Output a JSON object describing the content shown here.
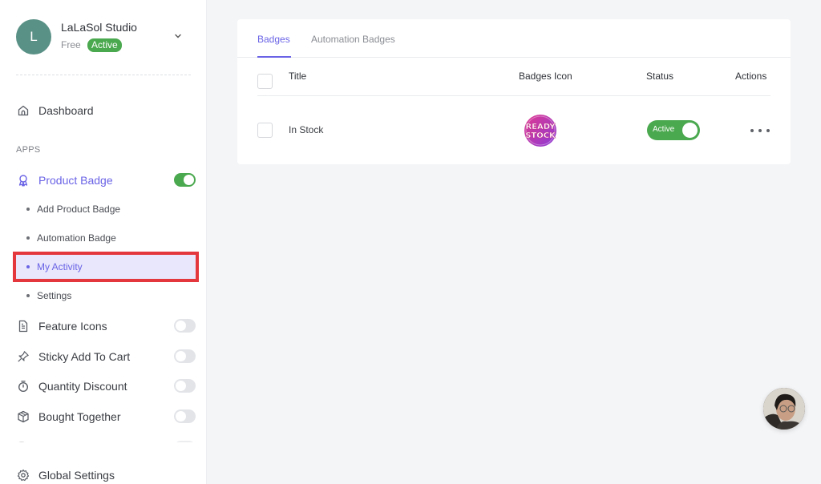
{
  "account": {
    "initial": "L",
    "name": "LaLaSol Studio",
    "plan": "Free",
    "status": "Active"
  },
  "sidebar": {
    "dashboard": {
      "label": "Dashboard",
      "icon": "home-icon"
    },
    "section_label": "APPS",
    "apps": [
      {
        "label": "Product Badge",
        "icon": "badge-ribbon-icon",
        "enabled": true,
        "active": true
      },
      {
        "label": "Feature Icons",
        "icon": "document-icon",
        "enabled": false
      },
      {
        "label": "Sticky Add To Cart",
        "icon": "pin-icon",
        "enabled": false
      },
      {
        "label": "Quantity Discount",
        "icon": "stopwatch-icon",
        "enabled": false
      },
      {
        "label": "Bought Together",
        "icon": "box-icon",
        "enabled": false
      }
    ],
    "sub_items": [
      {
        "label": "Add Product Badge",
        "active": false
      },
      {
        "label": "Automation Badge",
        "active": false
      },
      {
        "label": "My Activity",
        "active": true,
        "highlighted": true
      },
      {
        "label": "Settings",
        "active": false
      }
    ],
    "global_settings": {
      "label": "Global Settings",
      "icon": "gear-icon"
    }
  },
  "main": {
    "tabs": [
      {
        "label": "Badges",
        "active": true
      },
      {
        "label": "Automation Badges",
        "active": false
      }
    ],
    "table": {
      "columns": [
        "Title",
        "Badges Icon",
        "Status",
        "Actions"
      ],
      "rows": [
        {
          "title": "In Stock",
          "badge_icon_text": [
            "READY",
            "STOCK"
          ],
          "status": "Active",
          "status_on": true
        }
      ]
    }
  },
  "colors": {
    "accent": "#6a63e6",
    "success": "#4aa84e",
    "highlight_border": "#e4373d",
    "avatar": "#5a9186"
  }
}
